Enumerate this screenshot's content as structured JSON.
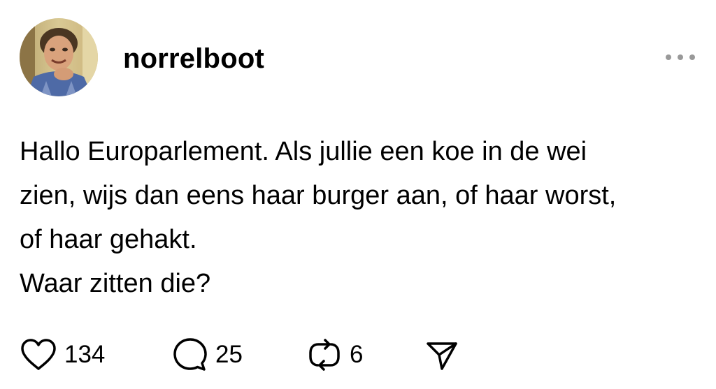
{
  "post": {
    "username": "norrelboot",
    "text_lines": [
      "Hallo Europarlement. Als jullie een koe in de wei",
      "zien, wijs dan eens haar burger aan, of haar worst,",
      "of haar gehakt.",
      "Waar zitten die?"
    ],
    "more_icon": "ellipsis-icon"
  },
  "actions": {
    "like": {
      "icon": "heart-icon",
      "count": "134"
    },
    "reply": {
      "icon": "comment-icon",
      "count": "25"
    },
    "repost": {
      "icon": "repost-icon",
      "count": "6"
    },
    "share": {
      "icon": "send-icon"
    }
  },
  "colors": {
    "text": "#000000",
    "muted": "#999999",
    "background": "#ffffff"
  }
}
